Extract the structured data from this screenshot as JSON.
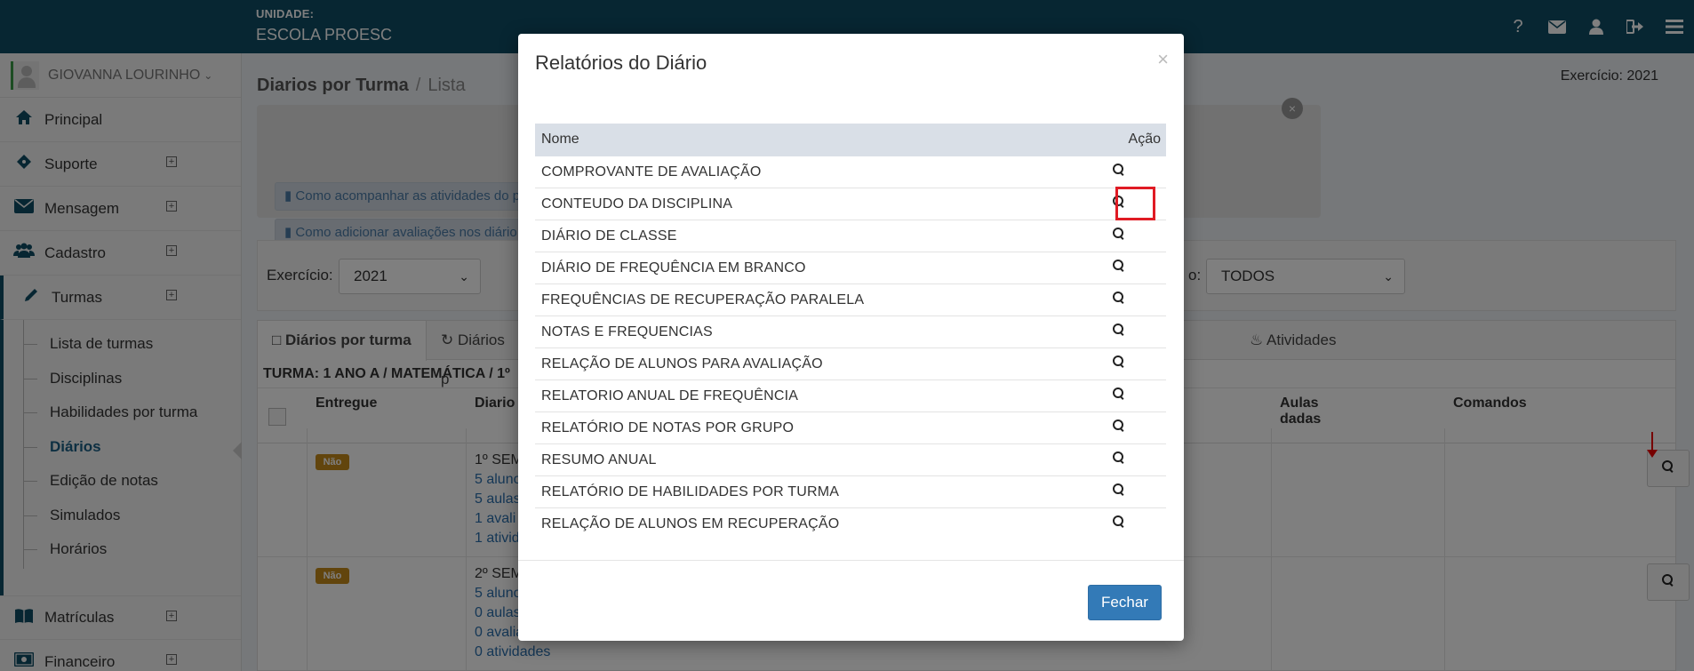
{
  "topbar": {
    "unit_label": "UNIDADE:",
    "unit_name": "ESCOLA PROESC",
    "icons": [
      "help-icon",
      "mail-icon",
      "user-icon",
      "logout-icon",
      "menu-icon"
    ]
  },
  "sidebar": {
    "user_name": "GIOVANNA LOURINHO",
    "items": [
      {
        "label": "Principal",
        "icon": "home-icon"
      },
      {
        "label": "Suporte",
        "icon": "ticket-icon"
      },
      {
        "label": "Mensagem",
        "icon": "envelope-icon"
      },
      {
        "label": "Cadastro",
        "icon": "users-icon"
      },
      {
        "label": "Turmas",
        "icon": "pencil-icon"
      }
    ],
    "submenu": [
      "Lista de turmas",
      "Disciplinas",
      "Habilidades por turma",
      "Diários",
      "Edição de notas",
      "Simulados",
      "Horários"
    ],
    "bottom_items": [
      {
        "label": "Matrículas",
        "icon": "book-icon"
      },
      {
        "label": "Financeiro",
        "icon": "money-icon"
      }
    ]
  },
  "main": {
    "breadcrumb_title": "Diarios por Turma",
    "breadcrumb_sep": "/",
    "breadcrumb_sub": "Lista",
    "exercise": "Exercício: 2021",
    "info_links": [
      "Como acompanhar as atividades do p",
      "Como adicionar avaliações nos diário"
    ],
    "filters": {
      "exercicio_label": "Exercício:",
      "exercicio_value": "2021",
      "right_label_fragment": "o:",
      "right_value": "TODOS"
    },
    "tabs": [
      "Diários por turma",
      "Diários p",
      "Atividades"
    ],
    "turma": "TURMA: 1 ANO A / MATEMÁTICA / 1º",
    "columns": {
      "entregue": "Entregue",
      "diario": "Diario",
      "aulas_line1": "Aulas",
      "aulas_line2": "dadas",
      "comandos": "Comandos"
    },
    "rows": [
      {
        "badge": "Não",
        "lines": [
          "1º SEM",
          "5 aluno",
          "5 aulas",
          "1 avali",
          "1 ativid"
        ]
      },
      {
        "badge": "Não",
        "lines": [
          "2º SEM",
          "5 aluno",
          "0 aulas",
          "0 avalia",
          "0 atividades"
        ]
      }
    ]
  },
  "modal": {
    "title": "Relatórios do Diário",
    "close": "×",
    "col_name": "Nome",
    "col_action": "Ação",
    "reports": [
      "COMPROVANTE DE AVALIAÇÃO",
      "CONTEUDO DA DISCIPLINA",
      "DIÁRIO DE CLASSE",
      "DIÁRIO DE FREQUÊNCIA EM BRANCO",
      "FREQUÊNCIAS DE RECUPERAÇÃO PARALELA",
      "NOTAS E FREQUENCIAS",
      "RELAÇÃO DE ALUNOS PARA AVALIAÇÃO",
      "RELATORIO ANUAL DE FREQUÊNCIA",
      "RELATÓRIO DE NOTAS POR GRUPO",
      "RESUMO ANUAL",
      "RELATÓRIO DE HABILIDADES POR TURMA",
      "RELAÇÃO DE ALUNOS EM RECUPERAÇÃO"
    ],
    "close_button": "Fechar",
    "highlight_color": "#e01b24"
  },
  "colors": {
    "topbar": "#0e4c64",
    "primary_button": "#337ab7",
    "badge": "#c48a1b"
  }
}
